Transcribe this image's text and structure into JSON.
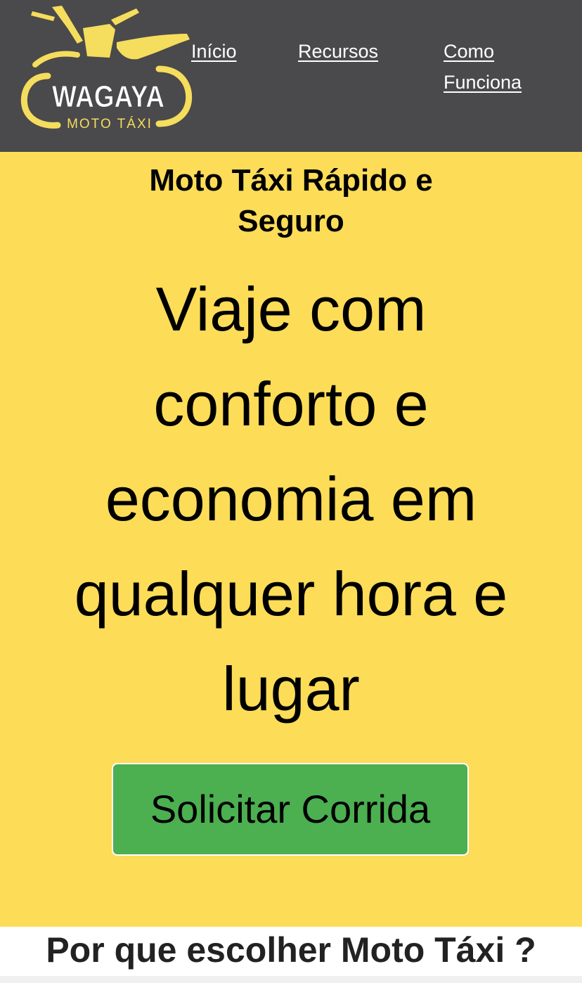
{
  "brand": {
    "logo_name": "WAGAYA",
    "logo_tagline": "MOTO TÁXI",
    "logo_color": "#f5dd5d"
  },
  "nav": {
    "items": [
      {
        "label": "Início"
      },
      {
        "label": "Recursos"
      },
      {
        "label": "Como Funciona"
      }
    ]
  },
  "hero": {
    "subtitle": "Moto Táxi Rápido e Seguro",
    "title": "Viaje com conforto e economia em qualquer hora e lugar",
    "cta_label": "Solicitar Corrida"
  },
  "features": {
    "title": "Por que escolher Moto Táxi ?"
  },
  "colors": {
    "header_bg": "#4a494b",
    "hero_bg": "#fddc58",
    "cta_bg": "#4caf50"
  }
}
